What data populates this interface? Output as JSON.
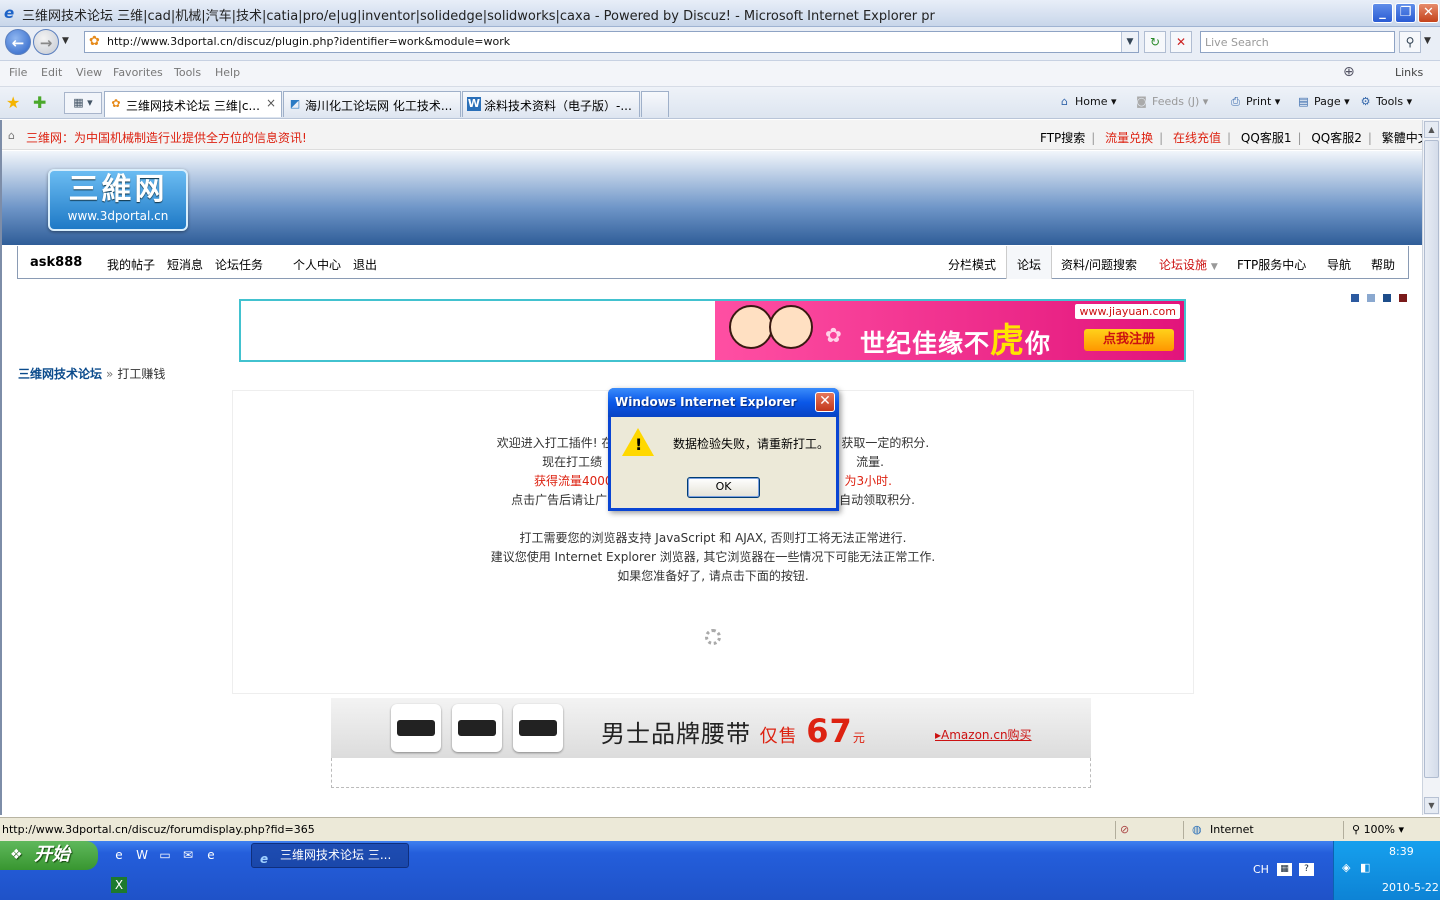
{
  "window": {
    "title": "三维网技术论坛 三维|cad|机械|汽车|技术|catia|pro/e|ug|inventor|solidedge|solidworks|caxa - Powered by Discuz! - Microsoft Internet Explorer pr",
    "minimize": "_",
    "restore": "❐",
    "close": "✕"
  },
  "addressbar": {
    "back": "←",
    "forward": "→",
    "history_dropdown": "▼",
    "url": "http://www.3dportal.cn/discuz/plugin.php?identifier=work&module=work",
    "refresh": "↻",
    "stop": "✕",
    "search_placeholder": "Live Search",
    "search_button": "⚲"
  },
  "menu": {
    "file": "File",
    "edit": "Edit",
    "view": "View",
    "favorites": "Favorites",
    "tools": "Tools",
    "help": "Help",
    "links": "Links"
  },
  "tabs": [
    {
      "label": "三维网技术论坛 三维|c...",
      "close": "×"
    },
    {
      "label": "海川化工论坛网 化工技术..."
    },
    {
      "label": "涂料技术资料（电子版）-..."
    }
  ],
  "commandbar": {
    "home": "Home",
    "feeds": "Feeds (J)",
    "print": "Print",
    "page": "Page",
    "tools": "Tools"
  },
  "site": {
    "slogan": "三维网：为中国机械制造行业提供全方位的信息资讯!",
    "toplinks": [
      "FTP搜索",
      "流量兑换",
      "在线充值",
      "QQ客服1",
      "QQ客服2",
      "繁體中文"
    ],
    "logo_main": "三維网",
    "logo_sub": "www.3dportal.cn",
    "nav_user": "ask888",
    "nav_left": [
      "我的帖子",
      "短消息",
      "论坛任务",
      "个人中心",
      "退出"
    ],
    "nav_right": [
      "分栏模式",
      "论坛",
      "资料/问题搜索",
      "论坛设施",
      "FTP服务中心",
      "导航",
      "帮助"
    ],
    "theme_colors": [
      "#2c5aa0",
      "#8aa8cf",
      "#1d4d8a",
      "#7a1a1a"
    ]
  },
  "ad_top": {
    "site": "www.jiayuan.com",
    "slogan_a": "世纪佳缘不",
    "slogan_tiger": "虎",
    "slogan_b": "你",
    "register": "点我注册"
  },
  "breadcrumb": {
    "home": "三维网技术论坛",
    "sep": "»",
    "current": "打工赚钱"
  },
  "main": {
    "line1a": "欢迎进入打工插件! 在",
    "line1b": "获取一定的积分.",
    "line2a": "现在打工绩",
    "line2b": "流量.",
    "line3a": "获得流量4000",
    "line3b": "为3小时.",
    "line4a": "点击广告后请让广",
    "line4b": "自动领取积分.",
    "line5": "打工需要您的浏览器支持 JavaScript 和 AJAX, 否则打工将无法正常进行.",
    "line6": "建议您使用 Internet Explorer 浏览器, 其它浏览器在一些情况下可能无法正常工作.",
    "line7": "如果您准备好了, 请点击下面的按钮."
  },
  "ad_belt": {
    "text": "男士品牌腰带",
    "sale": "仅售",
    "price": "67",
    "unit": "元",
    "link": "Amazon.cn购买"
  },
  "dialog": {
    "title": "Windows Internet Explorer",
    "message": "数据检验失败，请重新打工。",
    "ok": "OK",
    "close": "✕",
    "warn_mark": "!"
  },
  "status": {
    "url": "http://www.3dportal.cn/discuz/forumdisplay.php?fid=365",
    "zone": "Internet",
    "zoom": "100%"
  },
  "taskbar": {
    "start": "开始",
    "task": "三维网技术论坛 三...",
    "lang": "CH",
    "time": "8:39",
    "date": "2010-5-22"
  }
}
